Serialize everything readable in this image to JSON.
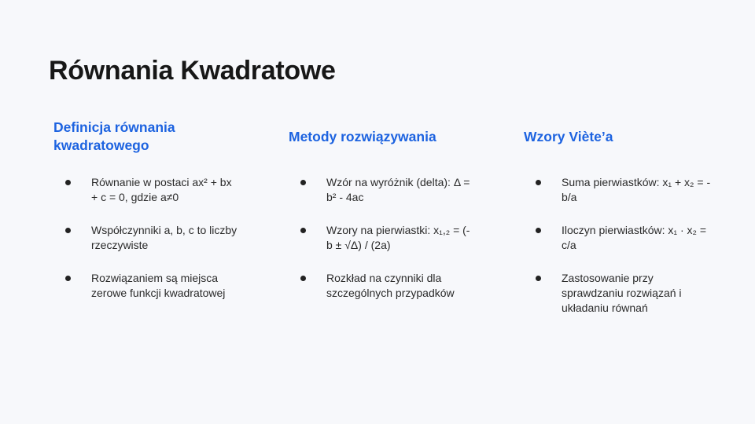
{
  "slide": {
    "title": "Równania Kwadratowe",
    "columns": [
      {
        "heading": "Definicja równania kwadratowego",
        "bullets": [
          "Równanie w postaci ax² + bx + c = 0, gdzie a≠0",
          "Współczynniki a, b, c to liczby rzeczywiste",
          "Rozwiązaniem są miejsca zerowe funkcji kwadratowej"
        ]
      },
      {
        "heading": "Metody rozwiązywania",
        "bullets": [
          "Wzór na wyróżnik (delta): Δ = b² - 4ac",
          "Wzory na pierwiastki: x₁,₂ = (-b ± √Δ) / (2a)",
          "Rozkład na czynniki dla szczególnych przypadków"
        ]
      },
      {
        "heading": "Wzory Viète’a",
        "bullets": [
          "Suma pierwiastków: x₁ + x₂ = -b/a",
          "Iloczyn pierwiastków: x₁ · x₂ = c/a",
          "Zastosowanie przy sprawdzaniu rozwiązań i układaniu równań"
        ]
      }
    ]
  },
  "colors": {
    "background": "#f7f8fb",
    "heading_accent": "#1d63e0",
    "title": "#171717",
    "body_text": "#2a2a2a"
  }
}
